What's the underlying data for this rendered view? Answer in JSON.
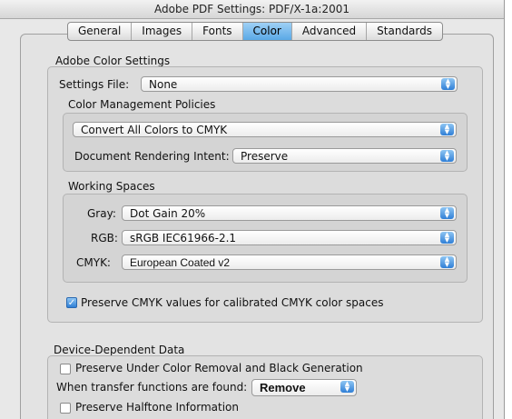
{
  "window": {
    "title": "Adobe PDF Settings: PDF/X-1a:2001"
  },
  "tabs": [
    {
      "label": "General",
      "selected": false
    },
    {
      "label": "Images",
      "selected": false
    },
    {
      "label": "Fonts",
      "selected": false
    },
    {
      "label": "Color",
      "selected": true
    },
    {
      "label": "Advanced",
      "selected": false
    },
    {
      "label": "Standards",
      "selected": false
    }
  ],
  "adobe_color_settings": {
    "heading": "Adobe Color Settings",
    "settings_file_label": "Settings File:",
    "settings_file_value": "None",
    "policies_heading": "Color Management Policies",
    "policy_value": "Convert All Colors to CMYK",
    "rendering_intent_label": "Document Rendering Intent:",
    "rendering_intent_value": "Preserve",
    "working_spaces_heading": "Working Spaces",
    "gray_label": "Gray:",
    "gray_value": "Dot Gain 20%",
    "rgb_label": "RGB:",
    "rgb_value": "sRGB IEC61966-2.1",
    "cmyk_label": "CMYK:",
    "cmyk_value": "European Coated v2",
    "preserve_cmyk_label": "Preserve CMYK values for calibrated CMYK color spaces",
    "preserve_cmyk_checked": true
  },
  "device_dependent": {
    "heading": "Device-Dependent Data",
    "ucr_label": "Preserve Under Color Removal and Black Generation",
    "ucr_checked": false,
    "transfer_label": "When transfer functions are found:",
    "transfer_value": "Remove",
    "halftone_label": "Preserve Halftone Information",
    "halftone_checked": false
  },
  "colors": {
    "selected_tab": "#5aa9e6",
    "popup_arrow": "#2f7fd6"
  }
}
